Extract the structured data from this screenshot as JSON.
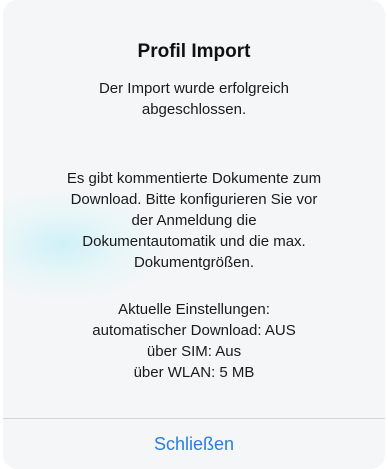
{
  "dialog": {
    "title": "Profil Import",
    "message_1": [
      "Der Import wurde erfolgreich",
      "abgeschlossen."
    ],
    "message_2": [
      "Es gibt kommentierte Dokumente zum",
      "Download. Bitte konfigurieren Sie vor",
      "der Anmeldung die",
      "Dokumentautomatik und die max.",
      "Dokumentgrößen."
    ],
    "message_3": [
      "Aktuelle Einstellungen:",
      "automatischer Download: AUS",
      "über SIM: Aus",
      "über WLAN: 5 MB"
    ],
    "close_label": "Schließen"
  },
  "colors": {
    "accent": "#2a7de1",
    "dialog_background": "#f5f6f7",
    "divider": "#d3d4d6"
  }
}
